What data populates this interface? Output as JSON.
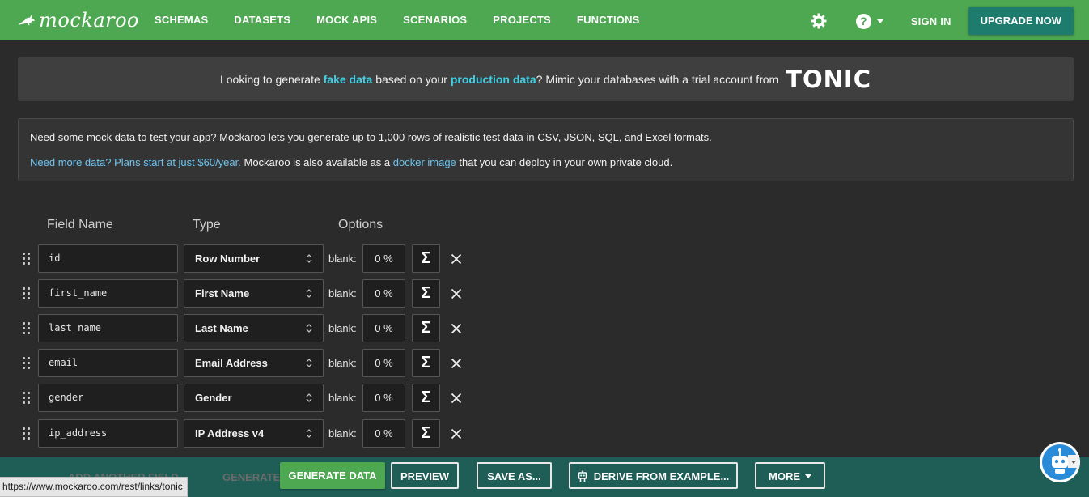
{
  "nav": {
    "logo_text": "mockaroo",
    "links": [
      "SCHEMAS",
      "DATASETS",
      "MOCK APIS",
      "SCENARIOS",
      "PROJECTS",
      "FUNCTIONS"
    ],
    "help_label": "?",
    "signin_label": "SIGN IN",
    "upgrade_label": "UPGRADE NOW"
  },
  "tonic_banner": {
    "text_1": "Looking to generate ",
    "highlight_1": "fake data",
    "text_2": " based on your ",
    "highlight_2": "production data",
    "text_3": "? Mimic your databases with a trial account from",
    "logo_text": "TONIC"
  },
  "info": {
    "line1": "Need some mock data to test your app? Mockaroo lets you generate up to 1,000 rows of realistic test data in CSV, JSON, SQL, and Excel formats.",
    "line2_link": "Need more data? Plans start at just $60/year.",
    "line2_text_a": " Mockaroo is also available as a ",
    "line2_docker": "docker image",
    "line2_text_b": " that you can deploy in your own private cloud."
  },
  "headers": {
    "field_name": "Field Name",
    "type": "Type",
    "options": "Options"
  },
  "fields": [
    {
      "name": "id",
      "type": "Row Number",
      "blank_label": "blank:",
      "blank": "0 %",
      "sigma": "Σ"
    },
    {
      "name": "first_name",
      "type": "First Name",
      "blank_label": "blank:",
      "blank": "0 %",
      "sigma": "Σ"
    },
    {
      "name": "last_name",
      "type": "Last Name",
      "blank_label": "blank:",
      "blank": "0 %",
      "sigma": "Σ"
    },
    {
      "name": "email",
      "type": "Email Address",
      "blank_label": "blank:",
      "blank": "0 %",
      "sigma": "Σ"
    },
    {
      "name": "gender",
      "type": "Gender",
      "blank_label": "blank:",
      "blank": "0 %",
      "sigma": "Σ"
    },
    {
      "name": "ip_address",
      "type": "IP Address v4",
      "blank_label": "blank:",
      "blank": "0 %",
      "sigma": "Σ"
    }
  ],
  "bottom_bar": {
    "hidden_add_label": "ADD ANOTHER FIELD",
    "hidden_generate_label": "GENERATE",
    "generate_label": "GENERATE DATA",
    "preview_label": "PREVIEW",
    "save_label": "SAVE AS...",
    "derive_label": "DERIVE FROM EXAMPLE...",
    "more_label": "MORE"
  },
  "status_url": "https://www.mockaroo.com/rest/links/tonic",
  "colors": {
    "nav_green": "#4ea751",
    "teal": "#1e7c6f",
    "highlight": "#3fd0e3",
    "link": "#6ec3ee",
    "bottom_bar": "#1f5e57"
  }
}
